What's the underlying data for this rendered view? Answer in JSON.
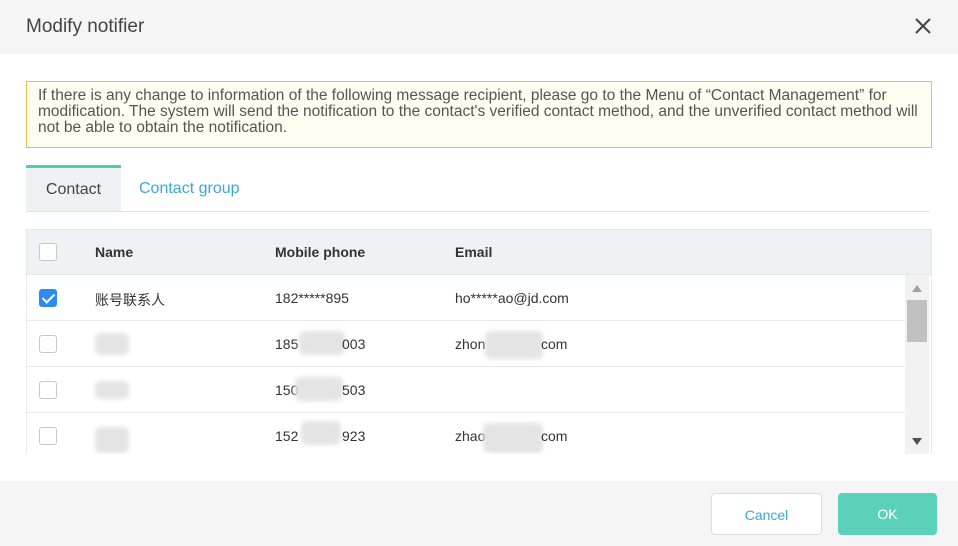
{
  "dialog": {
    "title": "Modify notifier",
    "notice": "If there is any change to information of the following message recipient, please go to the Menu of  “Contact Management”  for modification. The system will send the notification to the contact's verified contact method, and the unverified contact method will not be able to obtain the notification."
  },
  "tabs": [
    {
      "label": "Contact",
      "active": true
    },
    {
      "label": "Contact group",
      "active": false
    }
  ],
  "table": {
    "headers": {
      "name": "Name",
      "mobile": "Mobile phone",
      "email": "Email"
    },
    "rows": [
      {
        "checked": true,
        "name": "账号联系人",
        "mobile": "182*****895",
        "email": "ho*****ao@jd.com"
      },
      {
        "checked": false,
        "name": "",
        "mobile_prefix": "185",
        "mobile_suffix": "003",
        "email_prefix": "zhon",
        "email_suffix": "com"
      },
      {
        "checked": false,
        "name": "",
        "mobile_prefix": "150",
        "mobile_suffix": "503",
        "email_prefix": "",
        "email_suffix": ""
      },
      {
        "checked": false,
        "name": "",
        "mobile_prefix": "152",
        "mobile_suffix": "923",
        "email_prefix": "zhao",
        "email_suffix": "com"
      }
    ]
  },
  "footer": {
    "cancel_label": "Cancel",
    "ok_label": "OK"
  },
  "colors": {
    "accent": "#5bd1b9",
    "link": "#3aa8d8",
    "checkbox": "#2b8cf0",
    "notice_border": "#e8c14a"
  },
  "icons": {
    "close": "close-icon",
    "scroll_up": "arrow-up-icon",
    "scroll_down": "arrow-down-icon",
    "check": "checkmark-icon"
  }
}
